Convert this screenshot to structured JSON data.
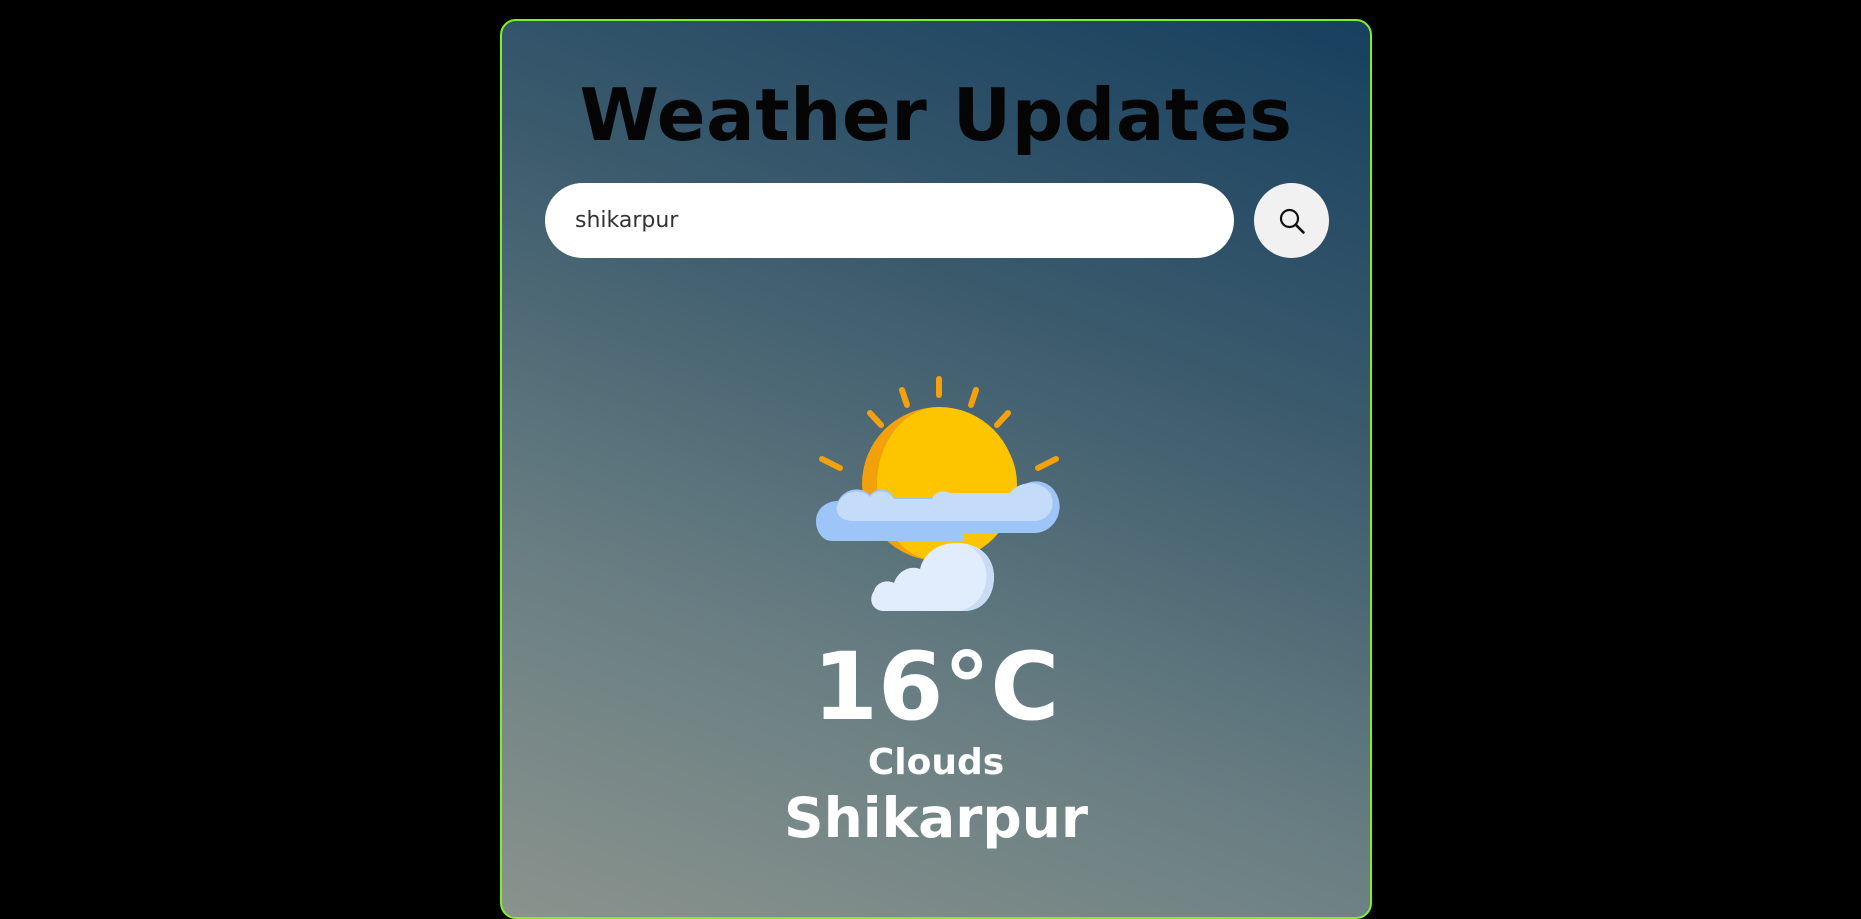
{
  "header": {
    "title": "Weather Updates"
  },
  "search": {
    "value": "shikarpur",
    "icon": "search-icon"
  },
  "weather": {
    "icon": "partly-cloudy-icon",
    "temperature": "16°C",
    "condition": "Clouds",
    "city": "Shikarpur"
  },
  "colors": {
    "border": "#7cf02a",
    "sun": "#fdc400",
    "sun_shade": "#f3a10b",
    "cloud_light": "#e1edfc",
    "cloud_blue": "#9ec5f7"
  }
}
